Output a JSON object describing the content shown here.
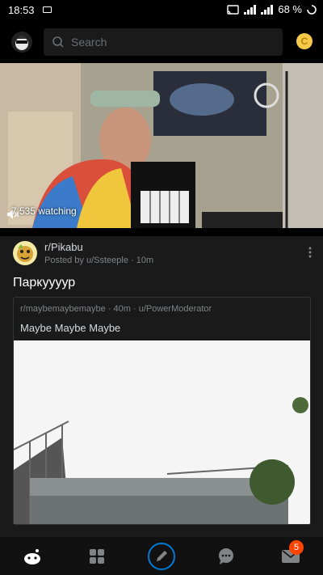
{
  "status": {
    "time": "18:53",
    "battery": "68 %"
  },
  "search": {
    "placeholder": "Search"
  },
  "coin": {
    "label": "C"
  },
  "video": {
    "watching": "7,535 watching"
  },
  "post": {
    "subreddit": "r/Pikabu",
    "posted_by": "Posted by u/Ssteeple · 10m",
    "title": "Паркуууур",
    "crosspost": {
      "meta": "r/maybemaybemaybe · 40m · u/PowerModerator",
      "title": "Maybe Maybe Maybe"
    }
  },
  "nav": {
    "inbox_badge": "5"
  },
  "colors": {
    "accent": "#ff4500",
    "coin": "#f6c94a",
    "edit_ring": "#0079d3"
  }
}
